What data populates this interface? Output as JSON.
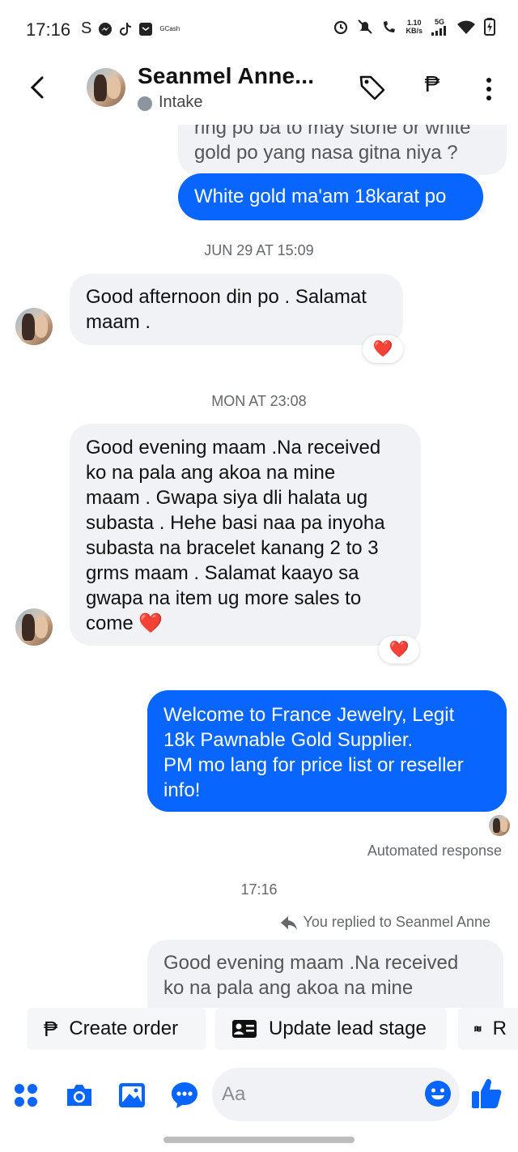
{
  "status_bar": {
    "time": "17:16",
    "left_icons": [
      "S",
      "messenger-icon",
      "tiktok-icon",
      "gcash-icon"
    ],
    "gcash_label": "GCash",
    "net_speed_value": "1.10",
    "net_speed_unit": "KB/s",
    "signal_label": "5G"
  },
  "header": {
    "contact_name": "Seanmel Anne...",
    "lead_stage": "Intake",
    "stage_color": "#8d949e",
    "peso_symbol": "₱"
  },
  "messages": {
    "top_question_partial": "ring po ba to may stone or white",
    "top_question": "gold po yang nasa gitna niya ?",
    "reply_white_gold": "White gold ma'am 18karat po",
    "stamp_jun29": "JUN 29 AT 15:09",
    "msg_afternoon_l1": "Good afternoon din po . Salamat",
    "msg_afternoon_l2": "maam .",
    "stamp_mon": "MON AT 23:08",
    "msg_evening_lines": [
      "Good evening maam .Na received",
      "ko na pala ang akoa na mine",
      "maam . Gwapa siya dli halata ug",
      "subasta . Hehe basi naa pa inyoha",
      "subasta na bracelet kanang 2 to 3",
      "grms maam . Salamat kaayo sa",
      "gwapa na item ug more sales to",
      "come"
    ],
    "heart_emoji": "❤️",
    "auto_reply_lines": [
      "Welcome to France Jewelry, Legit",
      "18k Pawnable Gold Supplier.",
      "PM mo lang for price list or reseller",
      "info!"
    ],
    "auto_response_label": "Automated response",
    "stamp_now": "17:16",
    "replied_label": "You replied to Seanmel Anne",
    "quoted_l1": "Good evening maam .Na received",
    "quoted_l2": "ko na pala ang akoa na mine"
  },
  "quick_actions": {
    "create_order": "Create order",
    "update_lead_stage": "Update lead stage",
    "third_partial": "R"
  },
  "composer": {
    "placeholder": "Aa",
    "accent_color": "#0866ff"
  }
}
